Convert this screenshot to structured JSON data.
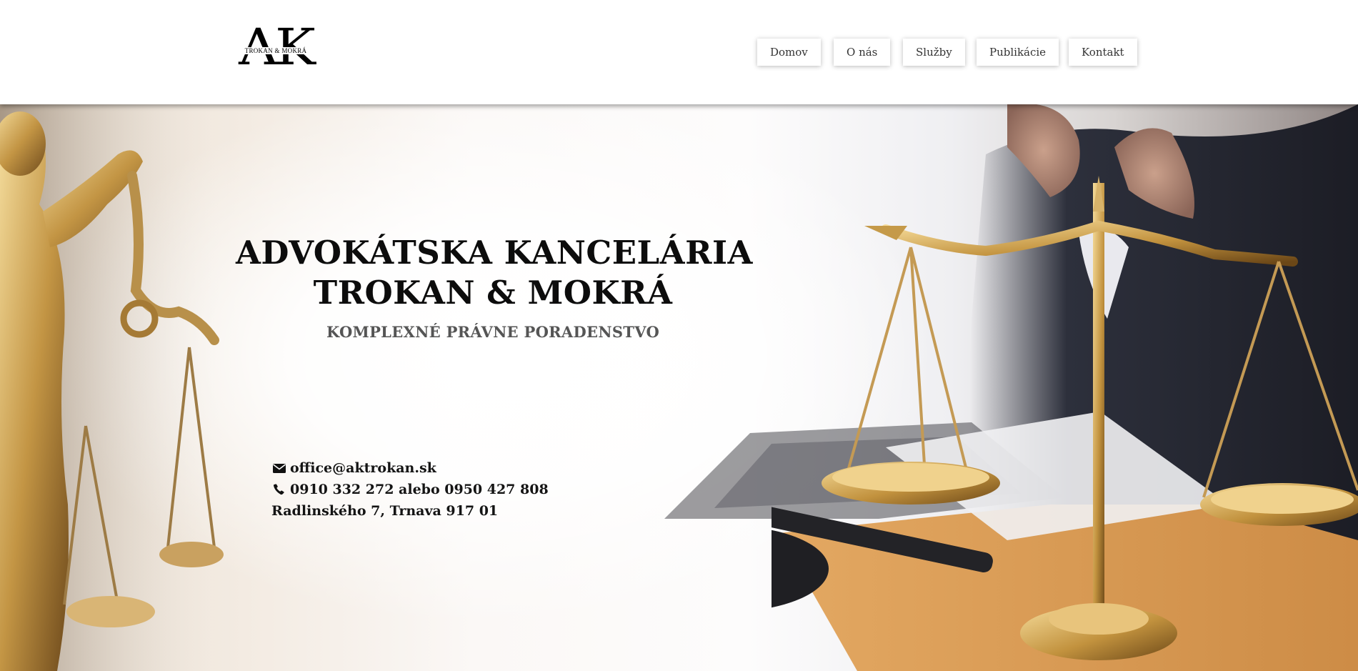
{
  "header": {
    "logo": {
      "letters": "AK",
      "subtitle": "TROKAN & MOKRÁ",
      "icon": "ak-logo"
    },
    "nav": [
      {
        "label": "Domov"
      },
      {
        "label": "O nás"
      },
      {
        "label": "Služby"
      },
      {
        "label": "Publikácie"
      },
      {
        "label": "Kontakt"
      }
    ]
  },
  "hero": {
    "title_line1": "ADVOKÁTSKA KANCELÁRIA",
    "title_line2": "TROKAN & MOKRÁ",
    "subtitle": "KOMPLEXNÉ PRÁVNE PORADENSTVO",
    "contact": {
      "email": "office@aktrokan.sk",
      "email_icon": "envelope-icon",
      "phone": "0910 332 272 alebo 0950 427 808",
      "phone_icon": "phone-icon",
      "address": "Radlinského 7, Trnava 917 01"
    },
    "images": [
      "justice-statue",
      "gavel",
      "laptop",
      "balance-scale"
    ]
  },
  "colors": {
    "text": "#111111",
    "subtitle": "#555555",
    "gold": "#c9a04a",
    "header_bg": "#ffffff"
  }
}
